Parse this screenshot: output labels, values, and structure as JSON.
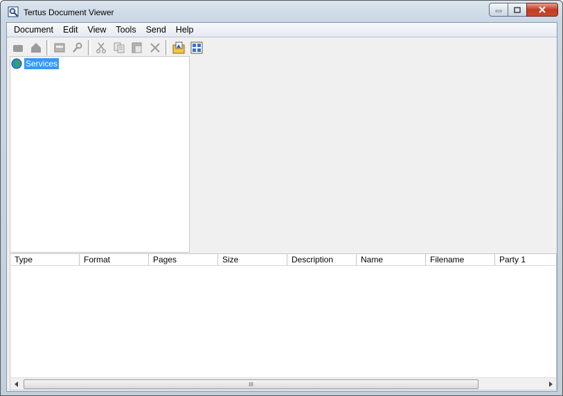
{
  "window": {
    "title": "Tertus Document Viewer"
  },
  "menu": [
    "Document",
    "Edit",
    "View",
    "Tools",
    "Send",
    "Help"
  ],
  "toolbar": {
    "groups": [
      [
        "stop-icon",
        "home-icon"
      ],
      [
        "window-icon",
        "search-icon"
      ],
      [
        "cut-icon",
        "copy-icon",
        "paste-icon",
        "delete-icon"
      ],
      [
        "open-folder-icon",
        "tile-view-icon"
      ]
    ]
  },
  "tree": {
    "root_label": "Services"
  },
  "list": {
    "columns": [
      "Type",
      "Format",
      "Pages",
      "Size",
      "Description",
      "Name",
      "Filename",
      "Party 1"
    ]
  },
  "scrollbar": {
    "thumb_grip": "III"
  },
  "colors": {
    "selection": "#3399ff",
    "close_button": "#c23b22"
  }
}
